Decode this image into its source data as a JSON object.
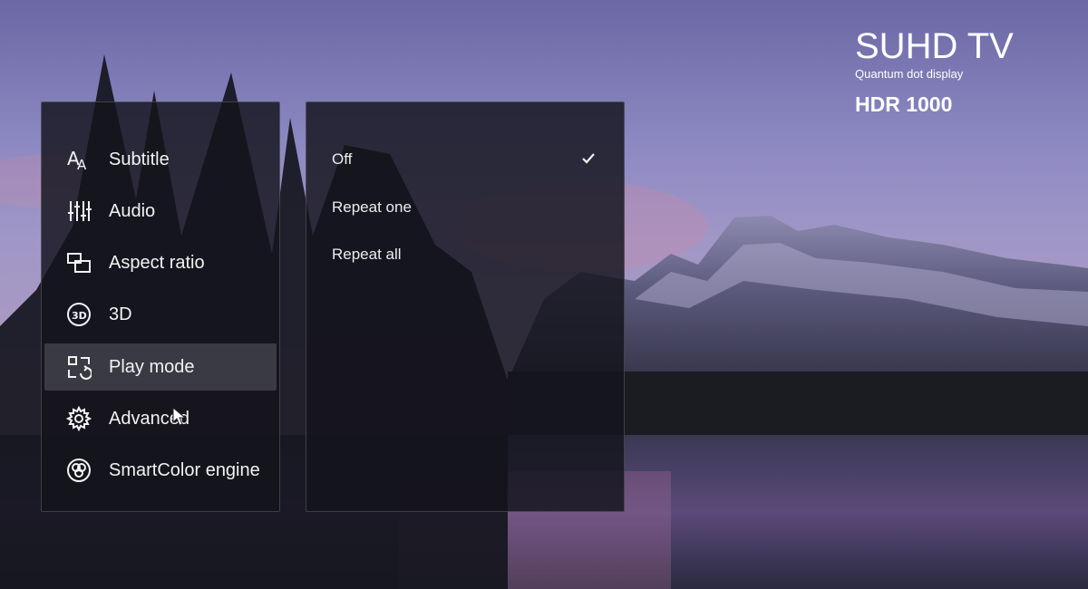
{
  "brand": {
    "title": "SUHD TV",
    "subtitle": "Quantum dot display",
    "hdr": "HDR 1000"
  },
  "menu": {
    "items": [
      {
        "label": "Subtitle",
        "icon": "subtitle-icon"
      },
      {
        "label": "Audio",
        "icon": "audio-icon"
      },
      {
        "label": "Aspect ratio",
        "icon": "aspect-ratio-icon"
      },
      {
        "label": "3D",
        "icon": "3d-icon"
      },
      {
        "label": "Play mode",
        "icon": "play-mode-icon",
        "selected": true
      },
      {
        "label": "Advanced",
        "icon": "gear-icon"
      },
      {
        "label": "SmartColor engine",
        "icon": "smartcolor-icon"
      }
    ]
  },
  "options": {
    "items": [
      {
        "label": "Off",
        "checked": true
      },
      {
        "label": "Repeat one",
        "checked": false
      },
      {
        "label": "Repeat all",
        "checked": false
      }
    ]
  },
  "colors": {
    "panel_bg": "#14141c",
    "text": "#f2f2f2",
    "selected_bg": "#5a5a64"
  }
}
